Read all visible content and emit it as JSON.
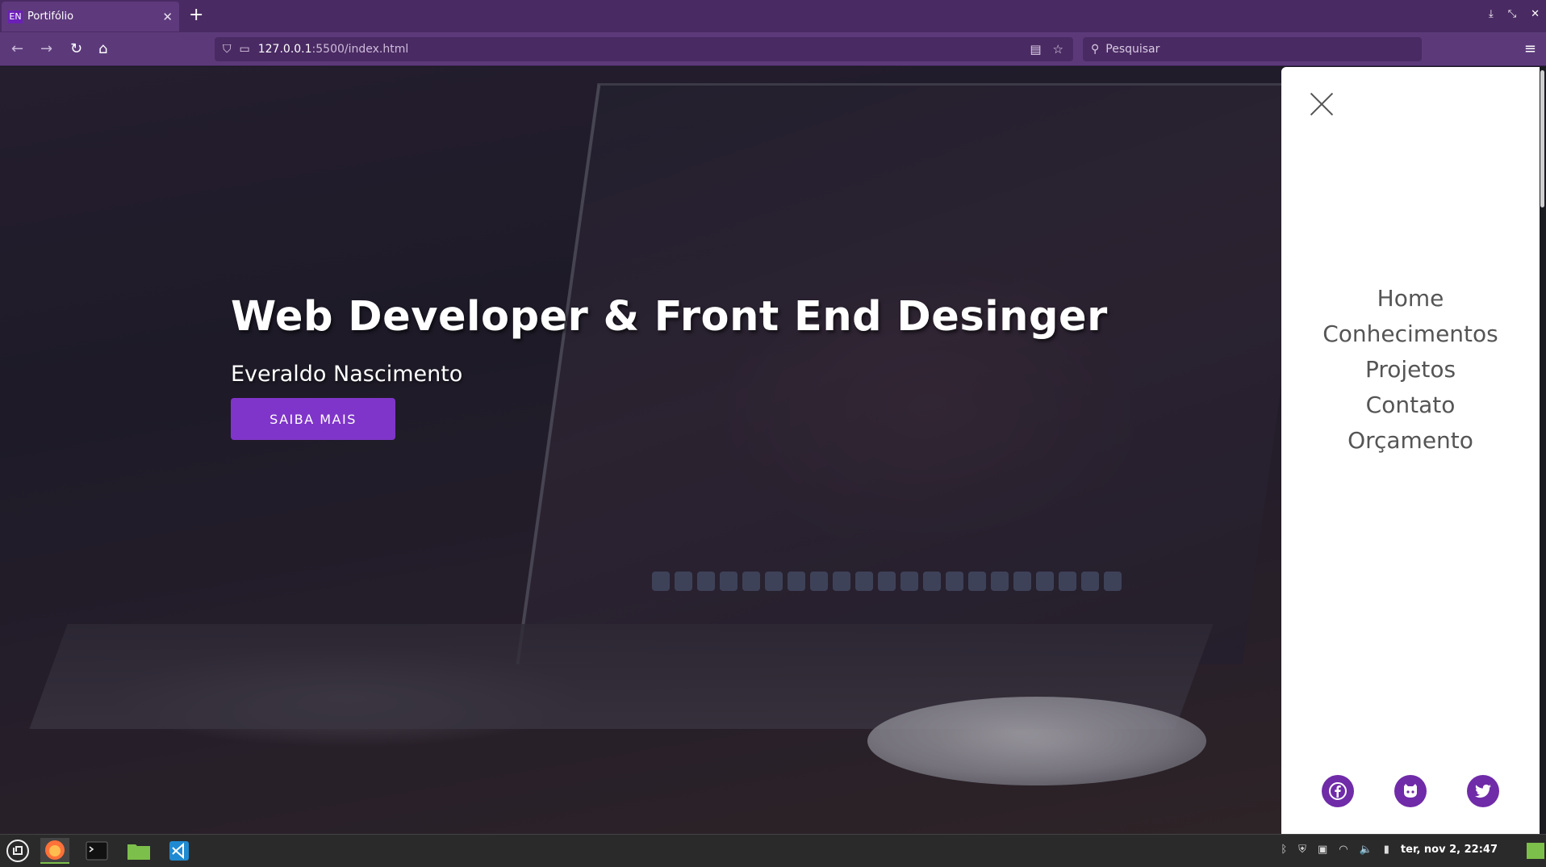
{
  "browser": {
    "tab_title": "Portifólio",
    "tab_favicon": "EN",
    "url_host": "127.0.0.1",
    "url_path": ":5500/index.html",
    "search_placeholder": "Pesquisar"
  },
  "hero": {
    "title": "Web Developer & Front End Desinger",
    "subtitle": "Everaldo Nascimento",
    "cta_label": "SAIBA MAIS"
  },
  "menu": {
    "items": [
      {
        "label": "Home"
      },
      {
        "label": "Conhecimentos"
      },
      {
        "label": "Projetos"
      },
      {
        "label": "Contato"
      },
      {
        "label": "Orçamento"
      }
    ],
    "social_icons": [
      "facebook-icon",
      "github-icon",
      "twitter-icon"
    ]
  },
  "taskbar": {
    "clock": "ter, nov 2, 22:47"
  },
  "colors": {
    "accent": "#7f35c9",
    "social": "#6f2ba8",
    "chrome": "#5c3a7a"
  }
}
